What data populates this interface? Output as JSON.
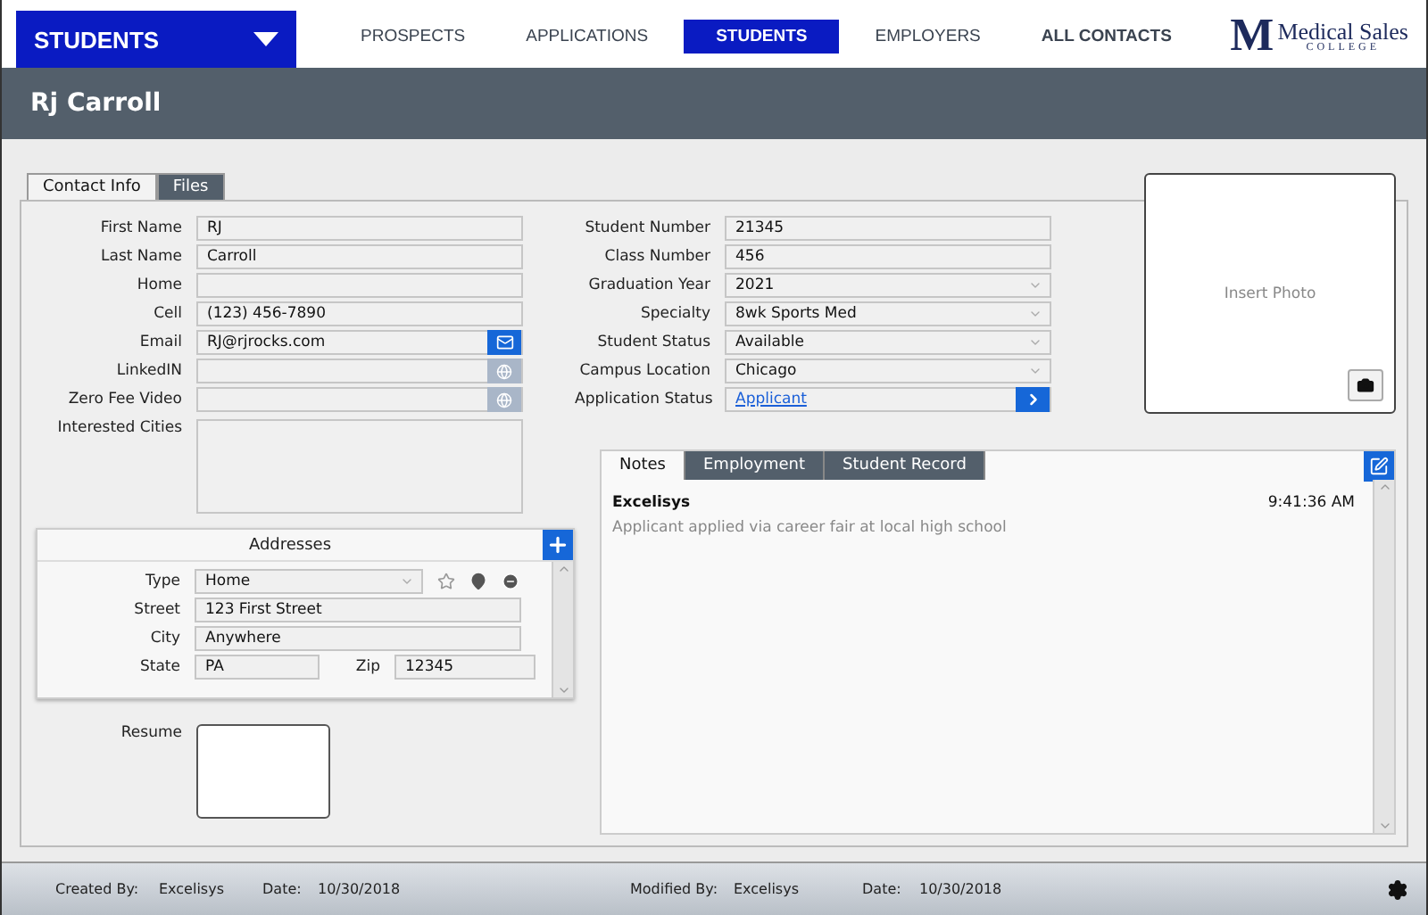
{
  "module_selector": {
    "label": "STUDENTS"
  },
  "nav": [
    {
      "label": "PROSPECTS",
      "kind": "module",
      "selected": false
    },
    {
      "label": "APPLICATIONS",
      "kind": "module",
      "selected": false
    },
    {
      "label": "STUDENTS",
      "kind": "module",
      "selected": true
    },
    {
      "label": "EMPLOYERS",
      "kind": "module",
      "selected": false
    },
    {
      "label": "ALL CONTACTS",
      "kind": "all",
      "selected": false
    }
  ],
  "logo": {
    "mark": "M",
    "name": "Medical Sales",
    "sub": "COLLEGE"
  },
  "record_title": "Rj Carroll",
  "tabs": [
    {
      "label": "Contact Info",
      "selected": true
    },
    {
      "label": "Files",
      "selected": false
    }
  ],
  "contact_fields": [
    {
      "label": "First Name",
      "value": "RJ",
      "kind": "text"
    },
    {
      "label": "Last Name",
      "value": "Carroll",
      "kind": "text"
    },
    {
      "label": "Home",
      "kind": "text"
    },
    {
      "label": "Cell",
      "value": "(123) 456-7890",
      "kind": "text"
    },
    {
      "label": "Email",
      "value": "RJ@rjrocks.com",
      "kind": "email"
    },
    {
      "label": "LinkedIN",
      "kind": "web"
    },
    {
      "label": "Zero Fee Video",
      "kind": "web"
    },
    {
      "label": "Interested Cities",
      "kind": "area"
    }
  ],
  "student_fields": [
    {
      "label": "Student Number",
      "value": "21345",
      "kind": "text"
    },
    {
      "label": "Class Number",
      "value": "456",
      "kind": "text"
    },
    {
      "label": "Graduation Year",
      "value": "2021",
      "kind": "select"
    },
    {
      "label": "Specialty",
      "value": "8wk Sports Med",
      "kind": "select"
    },
    {
      "label": "Student Status",
      "value": "Available",
      "kind": "select"
    },
    {
      "label": "Campus Location",
      "value": "Chicago",
      "kind": "select"
    },
    {
      "label": "Application Status",
      "value": "Applicant",
      "kind": "link"
    }
  ],
  "photo": {
    "placeholder": "Insert Photo"
  },
  "addresses": {
    "title": "Addresses",
    "type": {
      "label": "Type",
      "value": "Home"
    },
    "street": {
      "label": "Street",
      "value": "123 First Street"
    },
    "city": {
      "label": "City",
      "value": "Anywhere"
    },
    "state": {
      "label": "State",
      "value": "PA"
    },
    "zip": {
      "label": "Zip",
      "value": "12345"
    }
  },
  "resume": {
    "label": "Resume"
  },
  "note_tabs": [
    {
      "label": "Notes",
      "selected": true
    },
    {
      "label": "Employment",
      "selected": false
    },
    {
      "label": "Student Record",
      "selected": false
    }
  ],
  "notes": [
    {
      "author": "Excelisys",
      "time": "9:41:36 AM",
      "text": "Applicant applied via career fair at local high school"
    }
  ],
  "footer": [
    {
      "label": "Created By:",
      "value": "Excelisys"
    },
    {
      "label": "Date:",
      "value": "10/30/2018"
    },
    {
      "label": "Modified By:",
      "value": "Excelisys"
    },
    {
      "label": "Date:",
      "value": "10/30/2018"
    }
  ]
}
